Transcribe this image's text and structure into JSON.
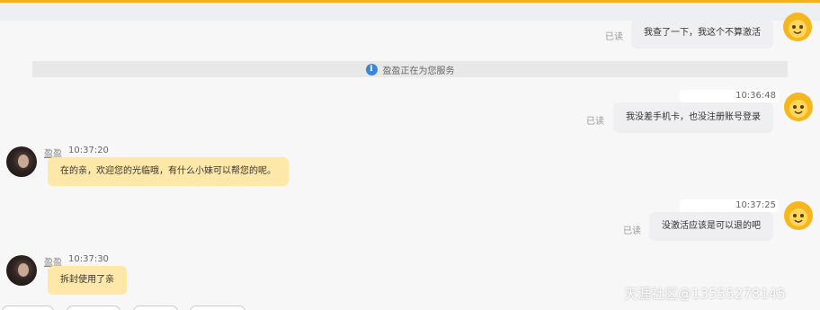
{
  "theme": {
    "accent": "#f3b21c",
    "self_bubble": "#efeff1",
    "other_bubble": "#fde7a9",
    "info": "#3a86d8"
  },
  "notice": {
    "icon": "info-icon",
    "text": "盈盈正在为您服务"
  },
  "messages": [
    {
      "side": "self",
      "read": "已读",
      "text": "我查了一下，我这个不算激活"
    },
    {
      "side": "self",
      "time": "10:36:48",
      "read": "已读",
      "text": "我没差手机卡，也没注册账号登录"
    },
    {
      "side": "other",
      "name": "盈盈",
      "time": "10:37:20",
      "text": "在的亲，欢迎您的光临哦，有什么小妹可以帮您的呢。"
    },
    {
      "side": "self",
      "time": "10:37:25",
      "read": "已读",
      "text": "没激活应该是可以退的吧"
    },
    {
      "side": "other",
      "name": "盈盈",
      "time": "10:37:30",
      "text": "拆封使用了亲"
    }
  ],
  "watermark": "天涯社区@13555278145"
}
